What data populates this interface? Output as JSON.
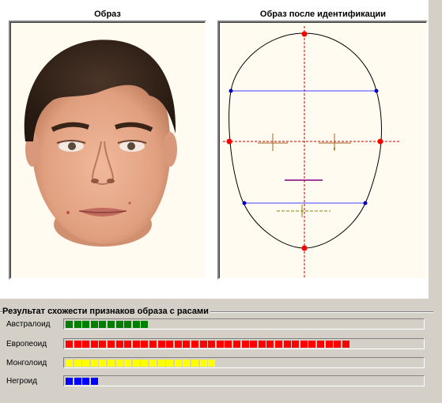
{
  "panels": {
    "left_title": "Образ",
    "right_title": "Образ после идентификации"
  },
  "results": {
    "title": "Результат схожести признаков образа с расами",
    "rows": [
      {
        "label": "Австралоид",
        "blocks": 10,
        "color": "#008000"
      },
      {
        "label": "Европеоид",
        "blocks": 34,
        "color": "#ff0000"
      },
      {
        "label": "Монголоид",
        "blocks": 18,
        "color": "#ffff00"
      },
      {
        "label": "Негроид",
        "blocks": 4,
        "color": "#0000ff"
      }
    ],
    "max_blocks": 43
  },
  "colors": {
    "panel_bg": "#fffbf0",
    "marker_red": "#ff0000",
    "marker_blue": "#0000c0",
    "line_blue": "#4040ff",
    "line_purple": "#800080",
    "line_dashed_red": "#cc0000",
    "line_olive": "#808000"
  }
}
